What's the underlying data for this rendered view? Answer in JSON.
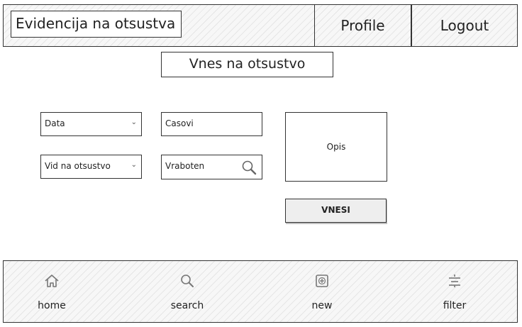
{
  "header": {
    "app_title": "Evidencija na otsustva",
    "profile_label": "Profile",
    "logout_label": "Logout"
  },
  "form": {
    "title": "Vnes na otsustvo",
    "data_select": {
      "value": "Data"
    },
    "vid_select": {
      "value": "Vid na otsustvo"
    },
    "casovi_input": {
      "placeholder": "Casovi"
    },
    "vraboten_input": {
      "placeholder": "Vraboten"
    },
    "opis_label": "Opis",
    "submit_label": "VNESI"
  },
  "bottom_nav": {
    "items": [
      {
        "label": "home",
        "icon": "home-icon"
      },
      {
        "label": "search",
        "icon": "search-icon"
      },
      {
        "label": "new",
        "icon": "plus-square-icon"
      },
      {
        "label": "filter",
        "icon": "filter-icon"
      }
    ]
  }
}
